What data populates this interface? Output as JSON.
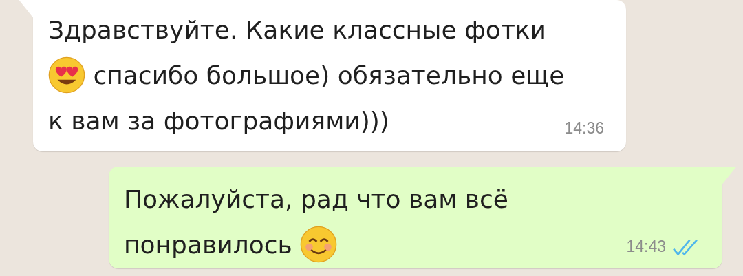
{
  "messages": [
    {
      "kind": "incoming",
      "time": "14:36",
      "lines": [
        [
          {
            "kind": "text",
            "text": "Здравствуйте. Какие классные фотки"
          }
        ],
        [
          {
            "kind": "heart_eyes"
          },
          {
            "kind": "text",
            "text": " спасибо большое) обязательно еще"
          }
        ],
        [
          {
            "kind": "text",
            "text": "к вам за фотографиями)))"
          }
        ]
      ]
    },
    {
      "kind": "outgoing",
      "time": "14:43",
      "read": true,
      "lines": [
        [
          {
            "kind": "text",
            "text": "Пожалуйста, рад что вам всё"
          }
        ],
        [
          {
            "kind": "text",
            "text": "понравилось "
          },
          {
            "kind": "smile"
          }
        ]
      ]
    }
  ]
}
